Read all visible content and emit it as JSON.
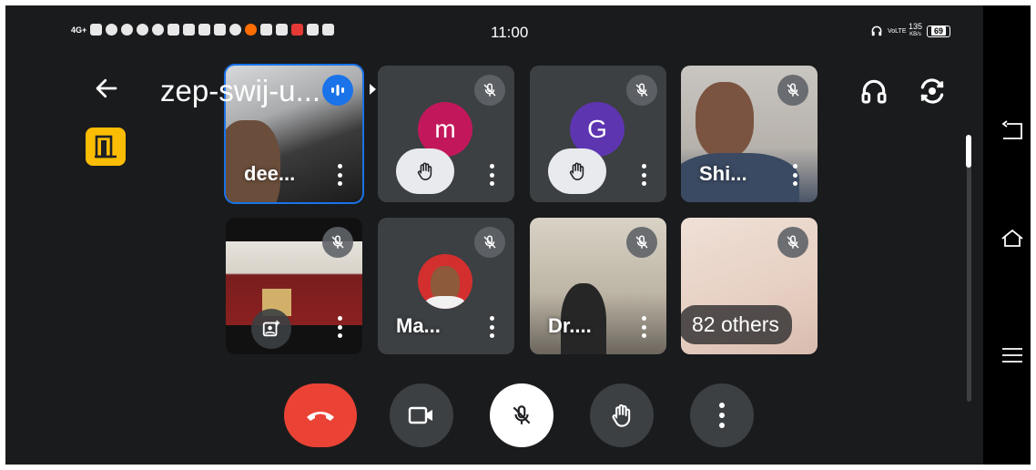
{
  "status_bar": {
    "time": "11:00",
    "network_left": "4G+",
    "volte": "VoLTE",
    "speed_value": "135",
    "speed_unit": "KB/s",
    "battery": "69"
  },
  "header": {
    "title": "zep-swij-u..."
  },
  "participants": [
    {
      "name": "dee...",
      "muted": false,
      "active_speaker": true,
      "type": "video"
    },
    {
      "name": "",
      "avatar_letter": "m",
      "avatar_color": "#c2185b",
      "muted": true,
      "hand_raised": true,
      "type": "avatar"
    },
    {
      "name": "",
      "avatar_letter": "G",
      "avatar_color": "#5e35b1",
      "muted": true,
      "hand_raised": true,
      "type": "avatar"
    },
    {
      "name": "Shi...",
      "muted": true,
      "type": "video"
    },
    {
      "name": "",
      "muted": true,
      "type": "presentation"
    },
    {
      "name": "Ma...",
      "muted": true,
      "type": "photo"
    },
    {
      "name": "Dr....",
      "muted": true,
      "type": "video"
    },
    {
      "name": "",
      "others_label": "82 others",
      "muted": true,
      "type": "others"
    }
  ],
  "controls": {
    "end_call": "end-call",
    "camera": "camera-off",
    "mic": "mic-off",
    "raise_hand": "raise-hand",
    "more": "more-options"
  },
  "colors": {
    "accent": "#1a73e8",
    "end_call": "#ea4335",
    "exit_badge": "#fbbc04",
    "background": "#1a1b1d"
  }
}
